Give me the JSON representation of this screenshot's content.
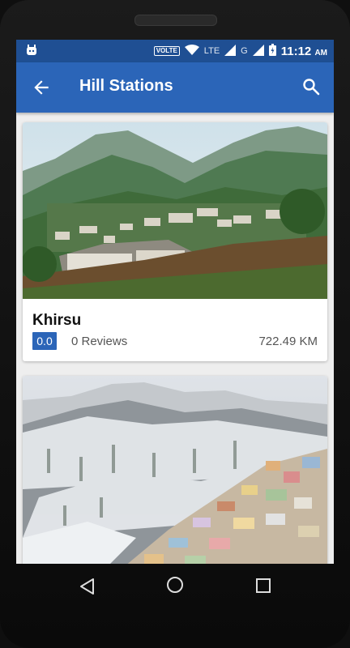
{
  "status_bar": {
    "volte": "VOLTE",
    "lte": "LTE",
    "g": "G",
    "time": "11:12",
    "ampm": "AM"
  },
  "app_bar": {
    "title": "Hill Stations",
    "back_icon": "arrow-back-icon",
    "search_icon": "search-icon"
  },
  "places": [
    {
      "name": "Khirsu",
      "rating": "0.0",
      "reviews": "0 Reviews",
      "distance": "722.49 KM"
    },
    {
      "name": "",
      "rating": "",
      "reviews": "",
      "distance": ""
    }
  ],
  "colors": {
    "primary": "#2b65b8",
    "status_bar": "#1f4f93",
    "background": "#eeeeee"
  }
}
